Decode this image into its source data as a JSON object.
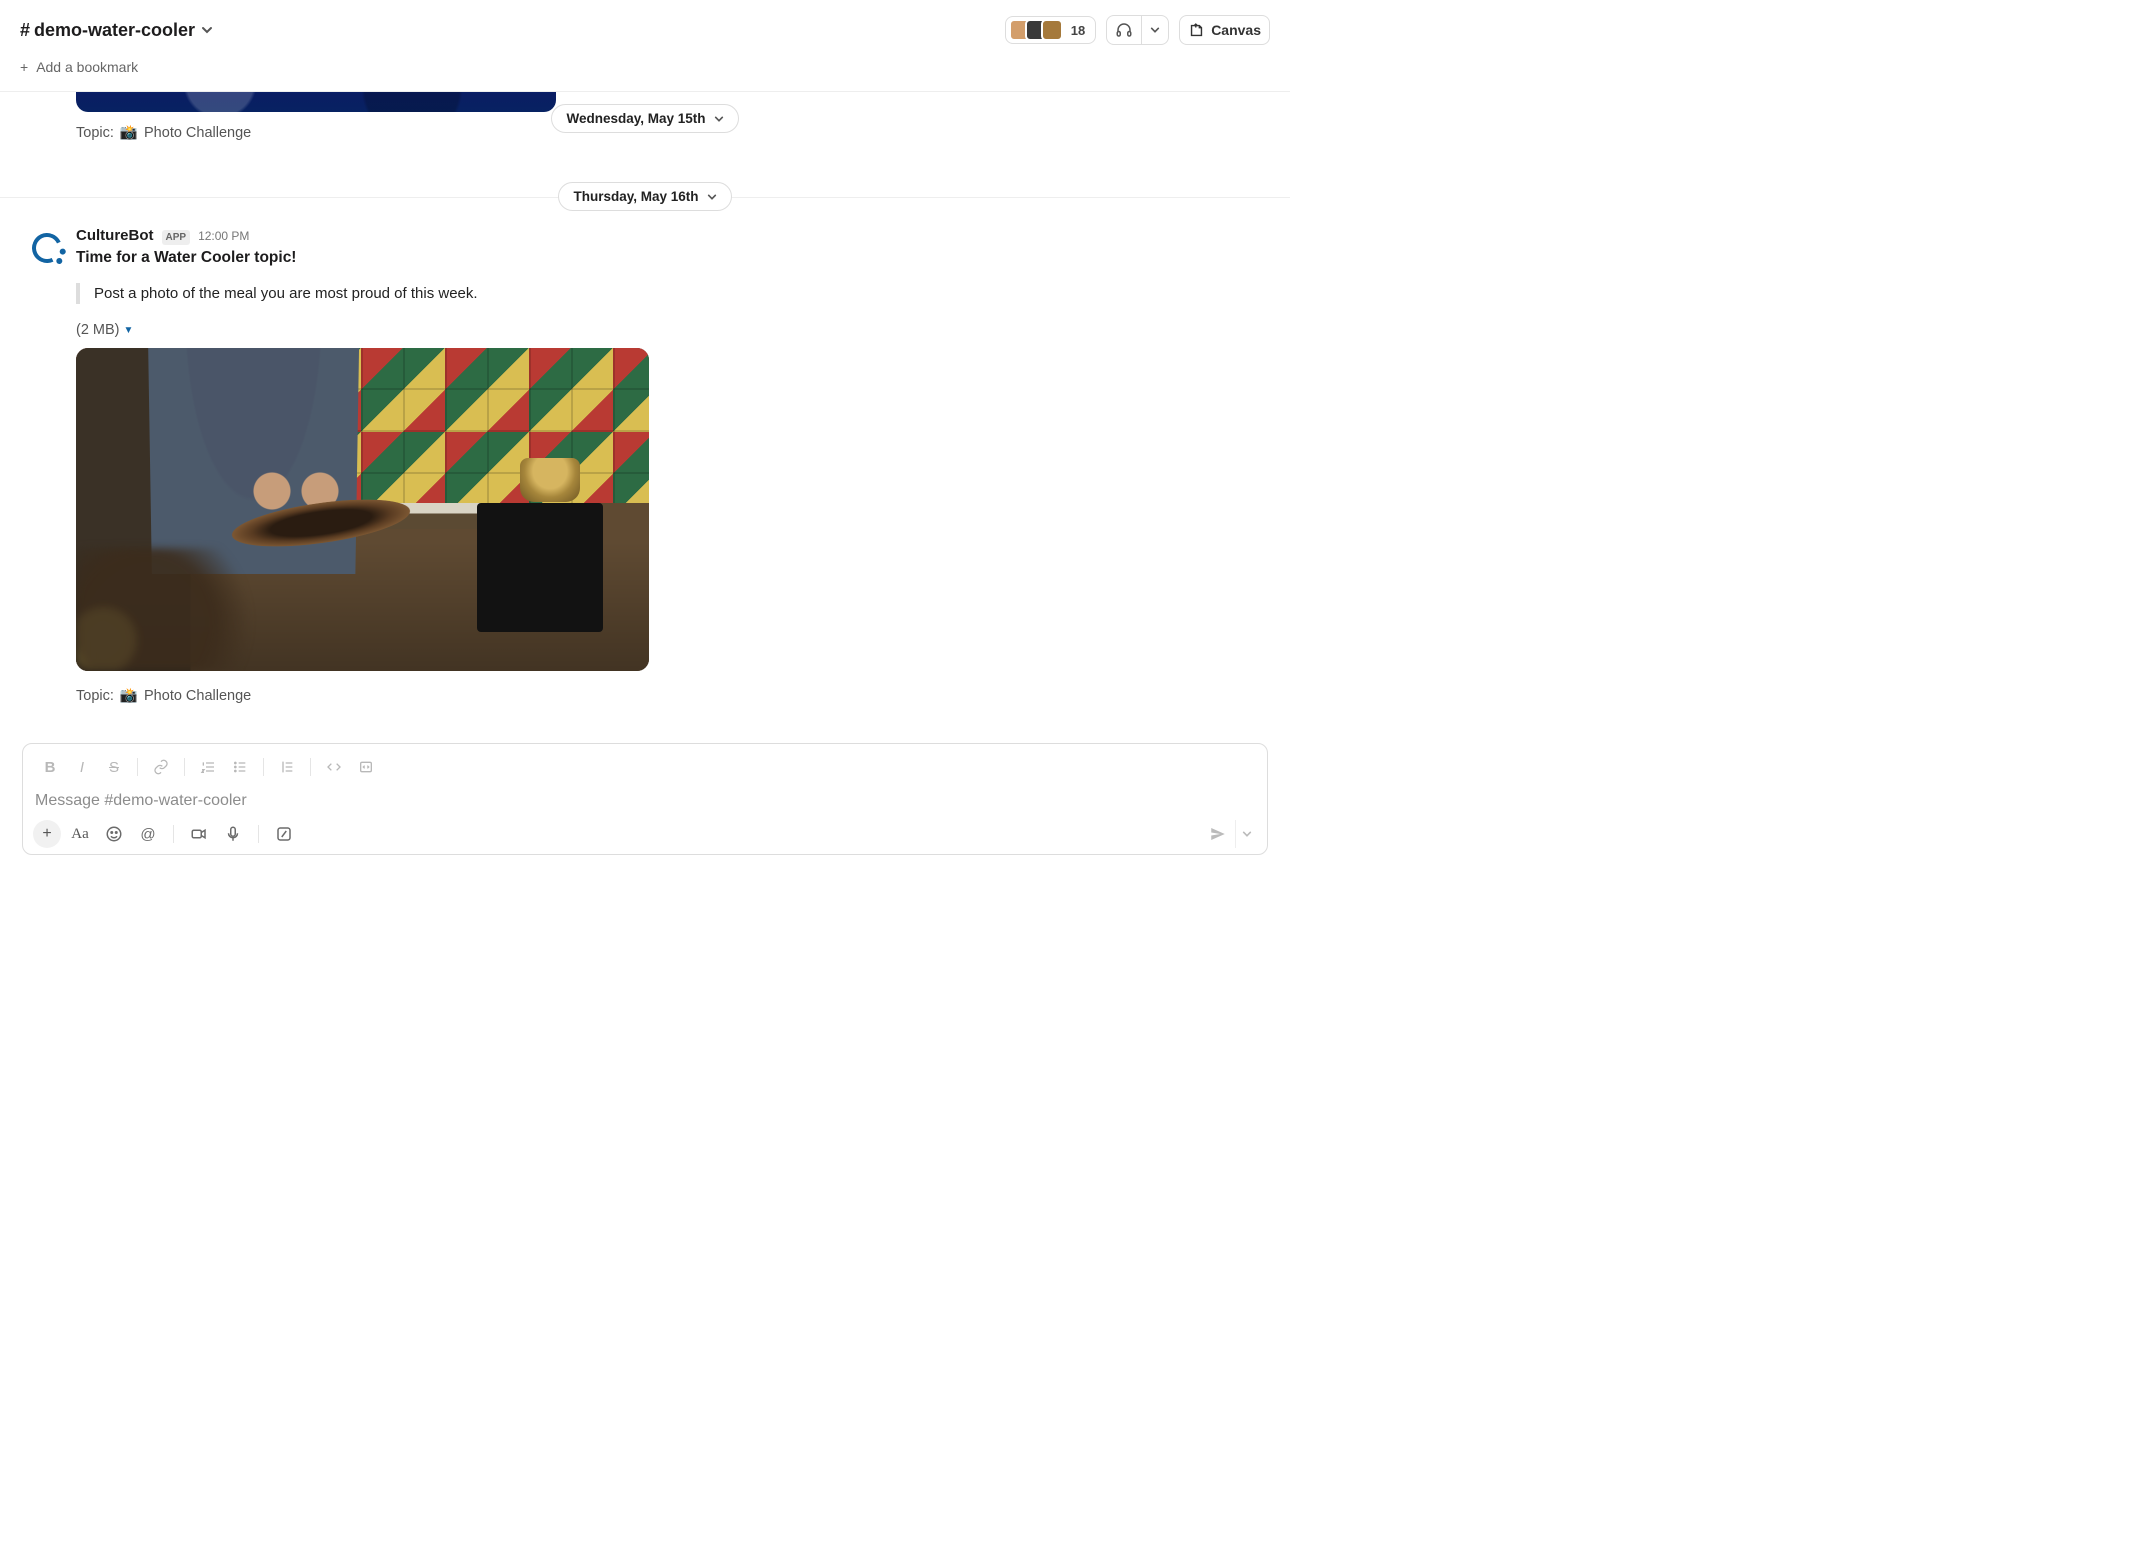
{
  "header": {
    "channel_name": "demo-water-cooler",
    "member_count": "18",
    "canvas_label": "Canvas",
    "add_bookmark": "Add a bookmark"
  },
  "dates": {
    "pill_top": "Wednesday, May 15th",
    "pill_mid": "Thursday, May 16th"
  },
  "partial_msg": {
    "topic_prefix": "Topic:",
    "topic_text": "Photo Challenge"
  },
  "message": {
    "author": "CultureBot",
    "badge": "APP",
    "time": "12:00 PM",
    "title": "Time for a Water Cooler topic!",
    "quote": "Post a photo of the meal you are most proud of this week.",
    "file_size": "(2 MB)",
    "topic_prefix": "Topic:",
    "topic_text": "Photo Challenge"
  },
  "composer": {
    "placeholder": "Message #demo-water-cooler"
  }
}
